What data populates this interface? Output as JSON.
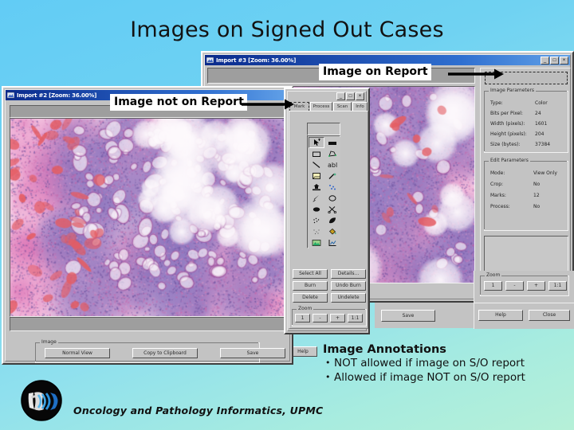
{
  "slide": {
    "title": "Images on Signed Out Cases",
    "background_top": "#62ccf5",
    "background_bottom": "#b6f0d8"
  },
  "callouts": {
    "on_report": "Image on Report",
    "not_on_report": "Image not on Report"
  },
  "window_import3": {
    "title": "Import #3 [Zoom: 36.00%]",
    "minimize": "_",
    "maximize": "□",
    "close": "×",
    "image_parameters": {
      "legend": "Image Parameters",
      "rows": [
        {
          "label": "Type:",
          "value": "Color"
        },
        {
          "label": "Bits per Pixel:",
          "value": "24"
        },
        {
          "label": "Width (pixels):",
          "value": "1601"
        },
        {
          "label": "Height (pixels):",
          "value": "204"
        },
        {
          "label": "Size (bytes):",
          "value": "37384"
        }
      ]
    },
    "edit_parameters": {
      "legend": "Edit Parameters",
      "rows": [
        {
          "label": "Mode:",
          "value": "View Only"
        },
        {
          "label": "Crop:",
          "value": "No"
        },
        {
          "label": "Marks:",
          "value": "12"
        },
        {
          "label": "Process:",
          "value": "No"
        }
      ]
    },
    "zoom_group": {
      "legend": "Zoom",
      "buttons": [
        "1",
        "-",
        "+",
        "1:1"
      ]
    },
    "help_label": "Help",
    "close_label": "Close",
    "save_label": "Save"
  },
  "window_import2": {
    "title": "Import #2 [Zoom: 36.00%]",
    "minimize": "_",
    "maximize": "□",
    "close": "×",
    "image_group": {
      "legend": "Image",
      "buttons": [
        "Normal View",
        "Copy to Clipboard",
        "Save"
      ]
    },
    "help_label": "Help"
  },
  "tool_window": {
    "minimize": "_",
    "maximize": "□",
    "close": "×",
    "tabs": [
      {
        "label": "Mark",
        "selected": true
      },
      {
        "label": "Process",
        "selected": false
      },
      {
        "label": "Scan",
        "selected": false
      },
      {
        "label": "Info",
        "selected": false
      }
    ],
    "palette": {
      "tools": [
        "arrow-select-icon",
        "rectangle-filled-icon",
        "rectangle-icon",
        "polygon-icon",
        "line-icon",
        "text-abl-icon",
        "note-icon",
        "magic-wand-icon",
        "stamp-icon",
        "dots-icon",
        "pointer-arrow-icon",
        "ellipse-icon",
        "blob-icon",
        "scissors-icon",
        "spray-icon",
        "leaf-icon",
        "speckle-icon",
        "paint-bucket-icon",
        "image-stamp-icon",
        "chart-icon"
      ]
    },
    "buttons": [
      "Select All",
      "Details...",
      "Burn",
      "Undo Burn",
      "Delete",
      "Undelete"
    ],
    "zoom_group": {
      "legend": "Zoom",
      "buttons": [
        "1",
        "-",
        "+",
        "1:1"
      ]
    }
  },
  "annotations": {
    "heading": "Image Annotations",
    "bullets": [
      "NOT allowed if image on S/O report",
      "Allowed if image NOT on S/O report"
    ]
  },
  "footer": {
    "text": "Oncology and Pathology Informatics, UPMC",
    "logo_name": "upmc-opi-logo"
  }
}
